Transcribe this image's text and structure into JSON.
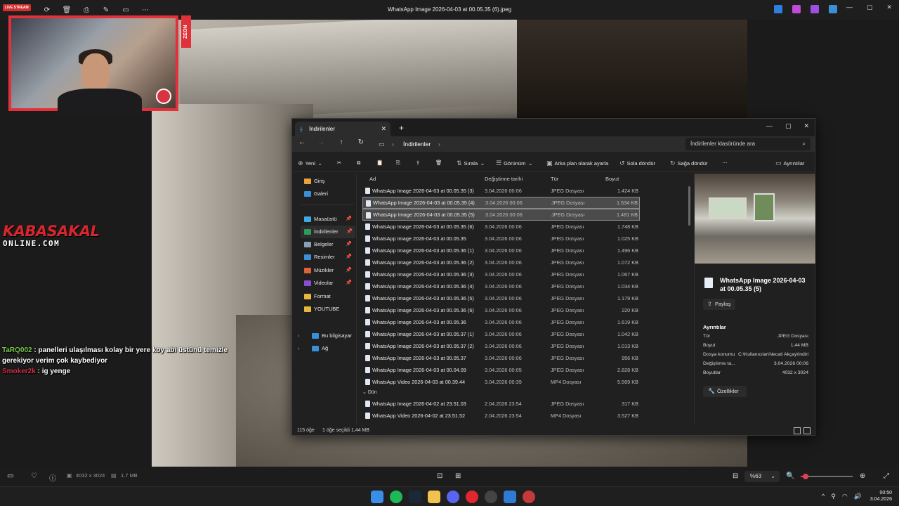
{
  "viewer": {
    "title": "WhatsApp Image 2026-04-03 at 00.05.35 (6).jpeg",
    "live_badge": "LIVE STREAM",
    "dimensions": "4032 x 3024",
    "file_size": "1.7 MB",
    "zoom": "%63",
    "zoom_slider_fraction": 0.1
  },
  "overlay": {
    "zeon_label": "ZEON",
    "logo_main": "KABASAKAL",
    "logo_sub": "ONLINE.COM",
    "chat": [
      {
        "user": "TaRQ002",
        "text": " : panelleri ulaşılması kolay bir yere koy abi üstünü temizle gerekiyor verim çok kaybediyor"
      },
      {
        "user": "Smoker2k",
        "text": " : ig yenge"
      }
    ]
  },
  "explorer": {
    "tab_title": "İndirilenler",
    "breadcrumb": "İndirilenler",
    "search_placeholder": "İndirilenler klasöründe ara",
    "commands": {
      "new": "Yeni",
      "sort": "Sırala",
      "view": "Görünüm",
      "set_bg": "Arka plan olarak ayarla",
      "rotate_left": "Sola döndür",
      "rotate_right": "Sağa döndür",
      "details": "Ayrıntılar"
    },
    "sidebar": [
      {
        "label": "Giriş",
        "color": "#e8a33d",
        "pin": false
      },
      {
        "label": "Galeri",
        "color": "#3a8fd9",
        "pin": false
      },
      {
        "label": "Masaüstü",
        "color": "#3fa9e0",
        "pin": true
      },
      {
        "label": "İndirilenler",
        "color": "#2a9d5c",
        "pin": true
      },
      {
        "label": "Belgeler",
        "color": "#8aa0b6",
        "pin": true
      },
      {
        "label": "Resimler",
        "color": "#3d8fd6",
        "pin": true
      },
      {
        "label": "Müzikler",
        "color": "#e0603a",
        "pin": true
      },
      {
        "label": "Videolar",
        "color": "#8a4fd0",
        "pin": true
      },
      {
        "label": "Format",
        "color": "#e8b63d",
        "pin": false
      },
      {
        "label": "YOUTUBE",
        "color": "#e8b63d",
        "pin": false
      },
      {
        "label": "Bu bilgisayar",
        "color": "#3a8fd9",
        "pin": false
      },
      {
        "label": "Ağ",
        "color": "#3a8fd9",
        "pin": false
      }
    ],
    "columns": {
      "name": "Ad",
      "date": "Değiştirme tarihi",
      "type": "Tür",
      "size": "Boyut"
    },
    "files": [
      {
        "name": "WhatsApp Image 2026-04-03 at 00.05.35 (3)",
        "date": "3.04.2026 00:06",
        "type": "JPEG Dosyası",
        "size": "1.424 KB"
      },
      {
        "name": "WhatsApp Image 2026-04-03 at 00.05.35 (4)",
        "date": "3.04.2026 00:06",
        "type": "JPEG Dosyası",
        "size": "1.534 KB"
      },
      {
        "name": "WhatsApp Image 2026-04-03 at 00.05.35 (5)",
        "date": "3.04.2026 00:06",
        "type": "JPEG Dosyası",
        "size": "1.481 KB"
      },
      {
        "name": "WhatsApp Image 2026-04-03 at 00.05.35 (6)",
        "date": "3.04.2026 00:06",
        "type": "JPEG Dosyası",
        "size": "1.748 KB"
      },
      {
        "name": "WhatsApp Image 2026-04-03 at 00.05.35",
        "date": "3.04.2026 00:06",
        "type": "JPEG Dosyası",
        "size": "1.025 KB"
      },
      {
        "name": "WhatsApp Image 2026-04-03 at 00.05.36 (1)",
        "date": "3.04.2026 00:06",
        "type": "JPEG Dosyası",
        "size": "1.496 KB"
      },
      {
        "name": "WhatsApp Image 2026-04-03 at 00.05.36 (2)",
        "date": "3.04.2026 00:06",
        "type": "JPEG Dosyası",
        "size": "1.072 KB"
      },
      {
        "name": "WhatsApp Image 2026-04-03 at 00.05.36 (3)",
        "date": "3.04.2026 00:06",
        "type": "JPEG Dosyası",
        "size": "1.067 KB"
      },
      {
        "name": "WhatsApp Image 2026-04-03 at 00.05.36 (4)",
        "date": "3.04.2026 00:06",
        "type": "JPEG Dosyası",
        "size": "1.034 KB"
      },
      {
        "name": "WhatsApp Image 2026-04-03 at 00.05.36 (5)",
        "date": "3.04.2026 00:06",
        "type": "JPEG Dosyası",
        "size": "1.179 KB"
      },
      {
        "name": "WhatsApp Image 2026-04-03 at 00.05.36 (6)",
        "date": "3.04.2026 00:06",
        "type": "JPEG Dosyası",
        "size": "220 KB"
      },
      {
        "name": "WhatsApp Image 2026-04-03 at 00.05.36",
        "date": "3.04.2026 00:06",
        "type": "JPEG Dosyası",
        "size": "1.619 KB"
      },
      {
        "name": "WhatsApp Image 2026-04-03 at 00.05.37 (1)",
        "date": "3.04.2026 00:06",
        "type": "JPEG Dosyası",
        "size": "1.042 KB"
      },
      {
        "name": "WhatsApp Image 2026-04-03 at 00.05.37 (2)",
        "date": "3.04.2026 00:06",
        "type": "JPEG Dosyası",
        "size": "1.013 KB"
      },
      {
        "name": "WhatsApp Image 2026-04-03 at 00.05.37",
        "date": "3.04.2026 00:06",
        "type": "JPEG Dosyası",
        "size": "956 KB"
      },
      {
        "name": "WhatsApp Image 2026-04-03 at 00.04.09",
        "date": "3.04.2026 00:05",
        "type": "JPEG Dosyası",
        "size": "2.828 KB"
      },
      {
        "name": "WhatsApp Video 2026-04-03 at 00.39.44",
        "date": "3.04.2026 00:39",
        "type": "MP4 Dosyası",
        "size": "5.569 KB"
      }
    ],
    "selected_indices": [
      1,
      2
    ],
    "group_yesterday": "Dün",
    "files_yesterday": [
      {
        "name": "WhatsApp Image 2026-04-02 at 23.51.03",
        "date": "2.04.2026 23:54",
        "type": "JPEG Dosyası",
        "size": "317 KB"
      },
      {
        "name": "WhatsApp Video 2026-04-02 at 23.51.52",
        "date": "2.04.2026 23:54",
        "type": "MP4 Dosyası",
        "size": "3.527 KB"
      }
    ],
    "preview": {
      "file_name": "WhatsApp Image 2026-04-03 at 00.05.35 (5)",
      "share": "Paylaş",
      "details_header": "Ayrıntılar",
      "details": [
        {
          "k": "Tür",
          "v": "JPEG Dosyası"
        },
        {
          "k": "Boyut",
          "v": "1,44 MB"
        },
        {
          "k": "Dosya konumu",
          "v": "C:\\Kullanıcılar\\Necati Akçay\\İndirilenler"
        },
        {
          "k": "Değiştirme ta...",
          "v": "3.04.2026 00:06"
        },
        {
          "k": "Boyutlar",
          "v": "4032 x 3024"
        }
      ],
      "properties": "Özellikler"
    },
    "status": {
      "count": "115 öğe",
      "selected": "1 öğe seçildi  1,44 MB"
    }
  },
  "taskbar": {
    "time": "00:50",
    "date": "3.04.2026",
    "apps": [
      {
        "name": "windows-start",
        "color": "#3b8ee8"
      },
      {
        "name": "spotify",
        "color": "#1db954"
      },
      {
        "name": "steam",
        "color": "#1b2838"
      },
      {
        "name": "file-explorer",
        "color": "#f2c14e"
      },
      {
        "name": "discord",
        "color": "#5865f2"
      },
      {
        "name": "opera",
        "color": "#e0262f"
      },
      {
        "name": "chatgpt",
        "color": "#444"
      },
      {
        "name": "photos",
        "color": "#2e7bd6"
      },
      {
        "name": "media-player",
        "color": "#c23a3a"
      }
    ]
  }
}
